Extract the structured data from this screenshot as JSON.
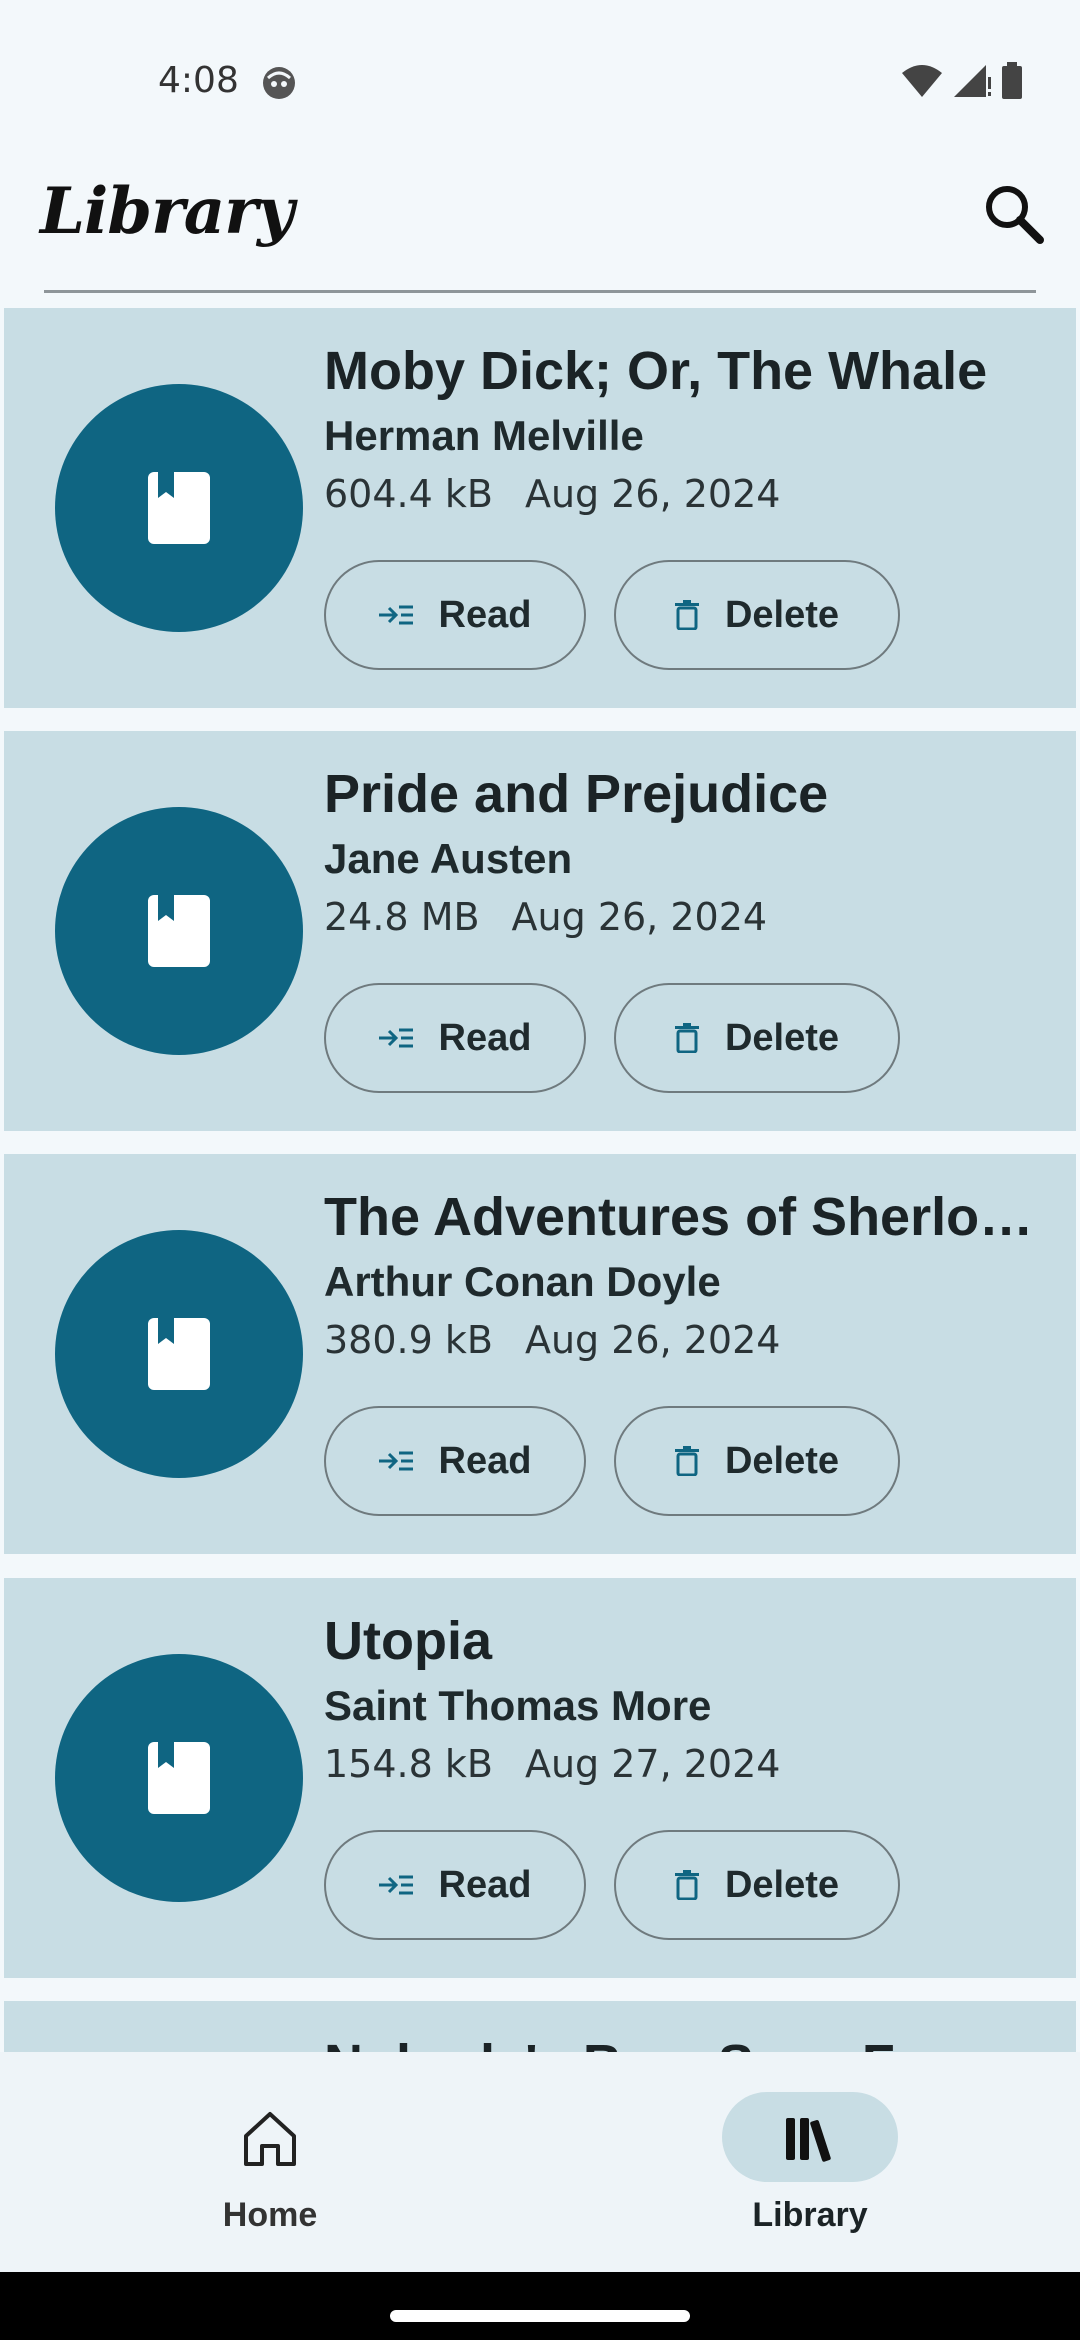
{
  "status_bar": {
    "time": "4:08"
  },
  "app_bar": {
    "title": "Library"
  },
  "books": [
    {
      "title": "Moby Dick; Or, The Whale",
      "author": "Herman Melville",
      "size": "604.4 kB",
      "date": "Aug 26, 2024",
      "read_label": "Read",
      "delete_label": "Delete"
    },
    {
      "title": "Pride and Prejudice",
      "author": "Jane Austen",
      "size": "24.8 MB",
      "date": "Aug 26, 2024",
      "read_label": "Read",
      "delete_label": "Delete"
    },
    {
      "title": "The Adventures of Sherlock Holmes",
      "author": "Arthur Conan Doyle",
      "size": "380.9 kB",
      "date": "Aug 26, 2024",
      "read_label": "Read",
      "delete_label": "Delete"
    },
    {
      "title": "Utopia",
      "author": "Saint Thomas More",
      "size": "154.8 kB",
      "date": "Aug 27, 2024",
      "read_label": "Read",
      "delete_label": "Delete"
    },
    {
      "title": "Nobody's Boy: Sans Famille",
      "author": "",
      "size": "",
      "date": "",
      "read_label": "",
      "delete_label": ""
    }
  ],
  "bottom_nav": {
    "items": [
      {
        "label": "Home",
        "icon": "home-icon",
        "selected": false
      },
      {
        "label": "Library",
        "icon": "library-icon",
        "selected": true
      }
    ]
  },
  "colors": {
    "card_background": "#c8dde4",
    "cover_accent": "#0f6582",
    "page_background": "#f3f8fb",
    "selected_nav_pill": "#c8dde4"
  }
}
